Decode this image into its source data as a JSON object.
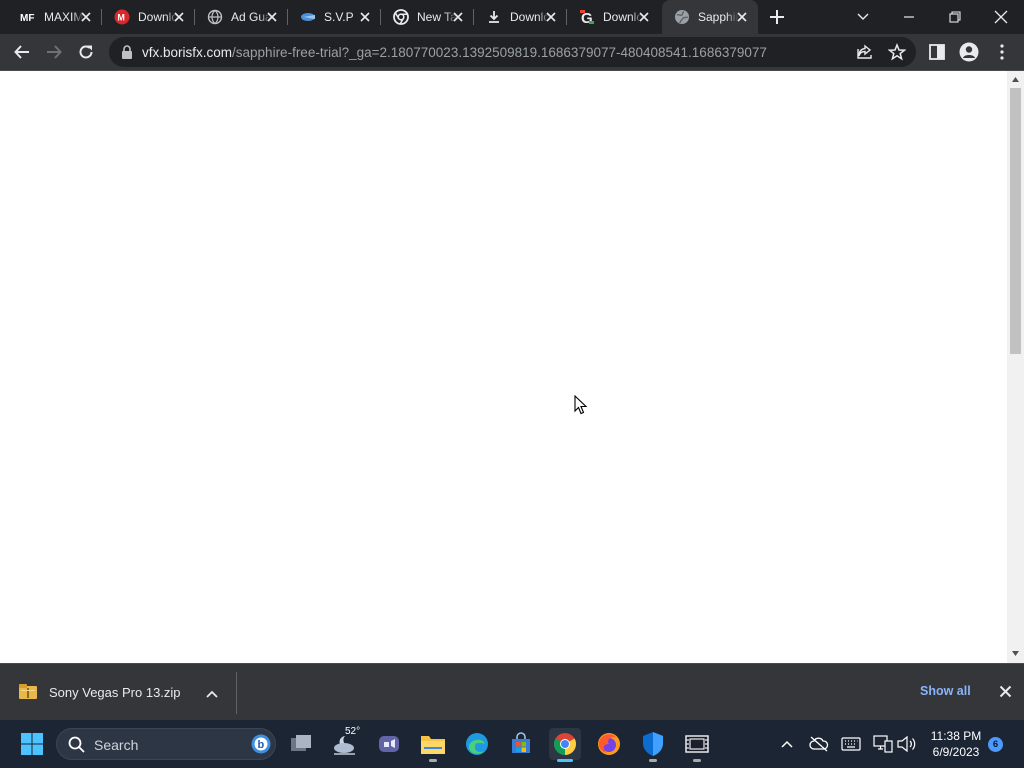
{
  "tabs": [
    {
      "title": "MAXIM",
      "favicon": "mf-icon",
      "active": false
    },
    {
      "title": "Download",
      "favicon": "mega-icon",
      "active": false
    },
    {
      "title": "Ad Guard",
      "favicon": "globe-icon",
      "active": false
    },
    {
      "title": "S.V.P",
      "favicon": "fish-icon",
      "active": false
    },
    {
      "title": "New Tab",
      "favicon": "chrome-icon",
      "active": false
    },
    {
      "title": "Downloads",
      "favicon": "download-icon",
      "active": false
    },
    {
      "title": "Download",
      "favicon": "g-icon",
      "active": false
    },
    {
      "title": "Sapphire",
      "favicon": "globe-icon",
      "active": true
    }
  ],
  "address_bar": {
    "host": "vfx.borisfx.com",
    "path": "/sapphire-free-trial?_ga=2.180770023.1392509819.1686379077-480408541.1686379077"
  },
  "download_shelf": {
    "file_name": "Sony Vegas Pro 13.zip",
    "show_all_label": "Show all"
  },
  "taskbar": {
    "search_label": "Search",
    "weather_temp": "52°",
    "time": "11:38 PM",
    "date": "6/9/2023",
    "notification_count": "6"
  },
  "colors": {
    "tabstrip_bg": "#202124",
    "toolbar_bg": "#35363a",
    "link_blue": "#8ab4f8",
    "taskbar_bg": "#1c2533"
  }
}
